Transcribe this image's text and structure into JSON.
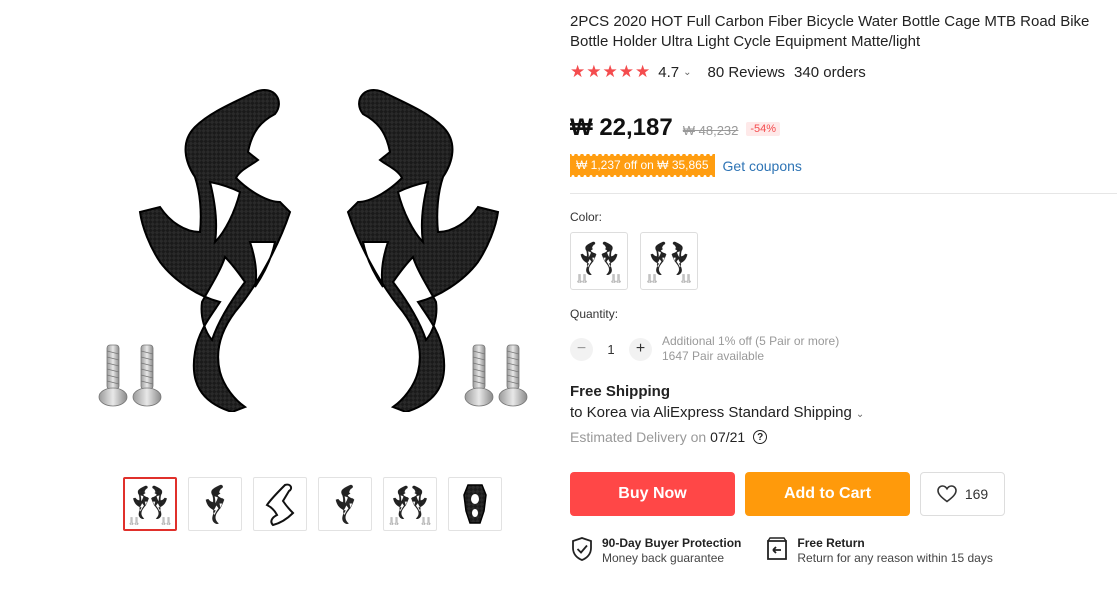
{
  "product": {
    "title": "2PCS 2020 HOT Full Carbon Fiber Bicycle Water Bottle Cage MTB Road Bike Bottle Holder Ultra Light Cycle Equipment Matte/light",
    "rating": "4.7",
    "reviews": "80 Reviews",
    "orders": "340 orders",
    "star_color": "#f44c4e"
  },
  "price": {
    "current": "₩ 22,187",
    "original": "₩ 48,232",
    "discount": "-54%"
  },
  "coupon": {
    "text": "₩ 1,237 off on ₩ 35,865",
    "link": "Get coupons"
  },
  "color": {
    "label": "Color:",
    "options": [
      "with screws",
      "with screws"
    ]
  },
  "quantity": {
    "label": "Quantity:",
    "value": "1",
    "additional": "Additional 1% off (5 Pair or more)",
    "available": "1647 Pair available"
  },
  "shipping": {
    "title": "Free Shipping",
    "method": "to Korea via AliExpress Standard Shipping",
    "delivery_label": "Estimated Delivery on",
    "delivery_date": "07/21"
  },
  "actions": {
    "buy_now": "Buy Now",
    "add_to_cart": "Add to Cart",
    "wishlist_count": "169",
    "buy_color": "#ff4747",
    "cart_color": "#ff9a0b"
  },
  "guarantees": [
    {
      "title": "90-Day Buyer Protection",
      "subtitle": "Money back guarantee",
      "icon": "shield-check-icon"
    },
    {
      "title": "Free Return",
      "subtitle": "Return for any reason within 15 days",
      "icon": "return-box-icon"
    }
  ],
  "gallery": {
    "thumbnail_count": 6,
    "active_index": 0
  }
}
